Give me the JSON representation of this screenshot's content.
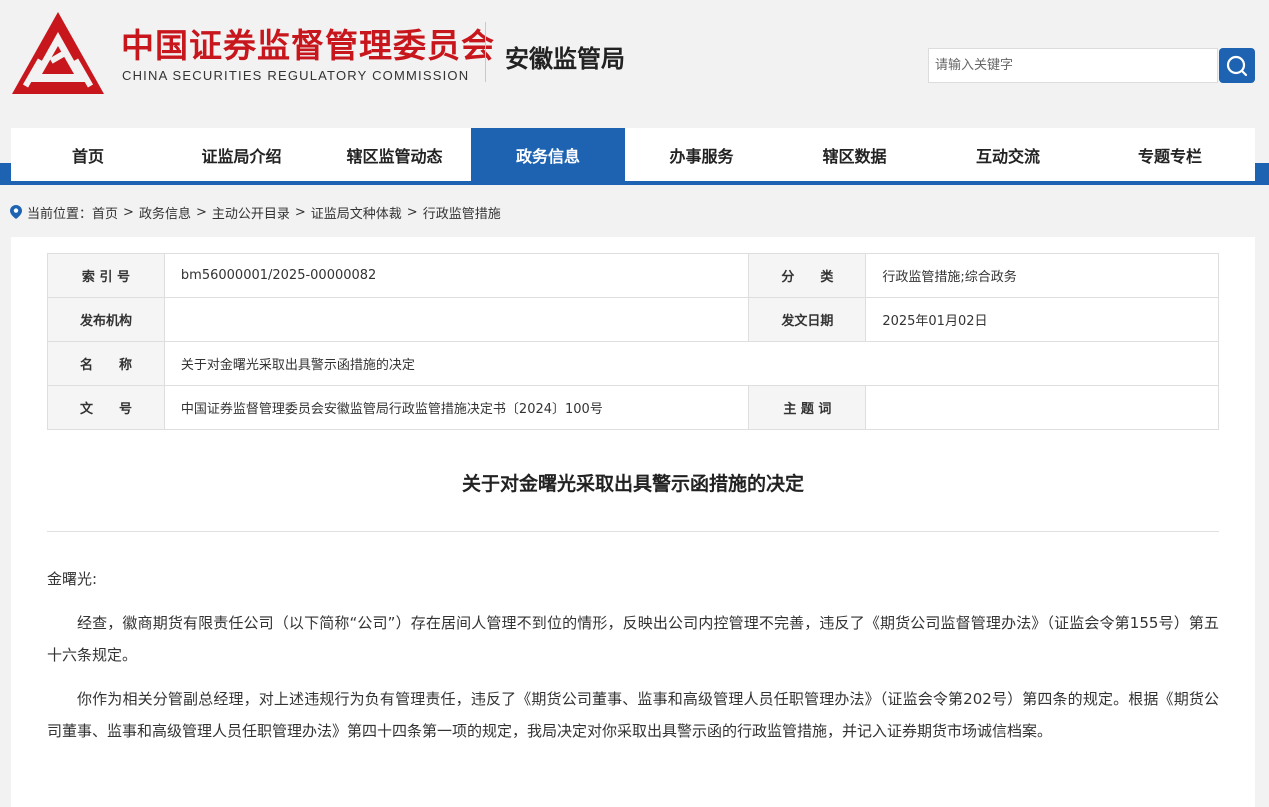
{
  "header": {
    "org_cn": "中国证券监督管理委员会",
    "org_en": "CHINA SECURITIES REGULATORY COMMISSION",
    "bureau": "安徽监管局",
    "search_placeholder": "请输入关键字",
    "brand_red": "#c8161d",
    "accent_blue": "#1d63b2"
  },
  "nav": {
    "items": [
      {
        "label": "首页"
      },
      {
        "label": "证监局介绍"
      },
      {
        "label": "辖区监管动态"
      },
      {
        "label": "政务信息",
        "active": true
      },
      {
        "label": "办事服务"
      },
      {
        "label": "辖区数据"
      },
      {
        "label": "互动交流"
      },
      {
        "label": "专题专栏"
      }
    ]
  },
  "breadcrumb": {
    "prefix": "当前位置：",
    "items": [
      "首页",
      "政务信息",
      "主动公开目录",
      "证监局文种体裁",
      "行政监管措施"
    ],
    "separator": ">"
  },
  "meta": {
    "index_label": "索 引 号",
    "index_value": "bm56000001/2025-00000082",
    "category_label": "分　　类",
    "category_value": "行政监管措施;综合政务",
    "issuer_label": "发布机构",
    "issuer_value": "",
    "date_label": "发文日期",
    "date_value": "2025年01月02日",
    "name_label": "名　　称",
    "name_value": "关于对金曙光采取出具警示函措施的决定",
    "docno_label": "文　　号",
    "docno_value": "中国证券监督管理委员会安徽监管局行政监管措施决定书〔2024〕100号",
    "subject_label": "主 题 词",
    "subject_value": ""
  },
  "document": {
    "title": "关于对金曙光采取出具警示函措施的决定",
    "salutation": "金曙光:",
    "paragraphs": [
      "经查，徽商期货有限责任公司（以下简称“公司”）存在居间人管理不到位的情形，反映出公司内控管理不完善，违反了《期货公司监督管理办法》（证监会令第155号）第五十六条规定。",
      "你作为相关分管副总经理，对上述违规行为负有管理责任，违反了《期货公司董事、监事和高级管理人员任职管理办法》（证监会令第202号）第四条的规定。根据《期货公司董事、监事和高级管理人员任职管理办法》第四十四条第一项的规定，我局决定对你采取出具警示函的行政监管措施，并记入证券期货市场诚信档案。"
    ]
  }
}
